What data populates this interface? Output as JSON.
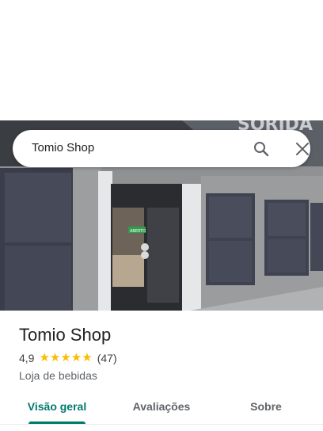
{
  "search": {
    "query": "Tomio Shop"
  },
  "storefront": {
    "sign_text": "SORIDA",
    "door_sign": "ABERTO"
  },
  "place": {
    "title": "Tomio Shop",
    "rating": "4,9",
    "stars": "★★★★★",
    "review_count": "(47)",
    "category": "Loja de bebidas"
  },
  "tabs": [
    {
      "label": "Visão geral",
      "active": true
    },
    {
      "label": "Avaliações",
      "active": false
    },
    {
      "label": "Sobre",
      "active": false
    }
  ],
  "colors": {
    "accent": "#00796b",
    "star": "#fbbc04"
  },
  "icons": {
    "search": "search-icon",
    "close": "close-icon"
  }
}
